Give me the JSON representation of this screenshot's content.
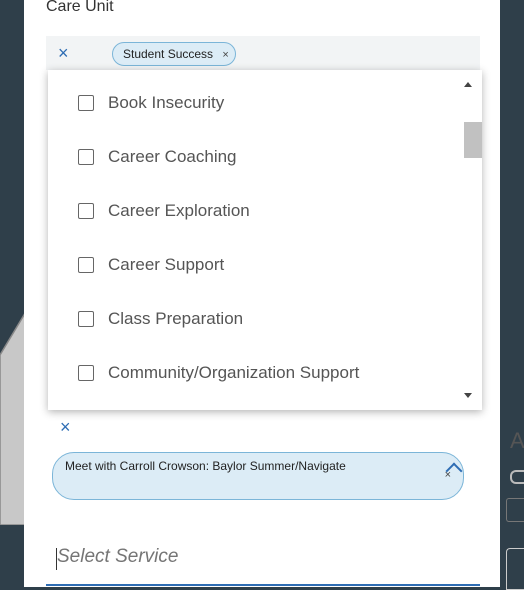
{
  "care_unit": {
    "label": "Care Unit",
    "clear_icon": "×",
    "chip_label": "Student Success",
    "chip_remove": "×"
  },
  "reason_dropdown": {
    "options": [
      "Book Insecurity",
      "Career Coaching",
      "Career Exploration",
      "Career Support",
      "Class Preparation",
      "Community/Organization Support"
    ]
  },
  "service": {
    "clear_icon": "×",
    "chip_label": "Meet with Carroll Crowson: Baylor Summer/Navigate",
    "chip_remove": "×",
    "placeholder": "Select Service"
  },
  "right_panel": {
    "partial_letter": "A"
  },
  "colors": {
    "accent": "#2e6db4",
    "chip_bg": "#dcecf6",
    "chip_border": "#7bb5d8",
    "backdrop": "#2f3f4a"
  }
}
